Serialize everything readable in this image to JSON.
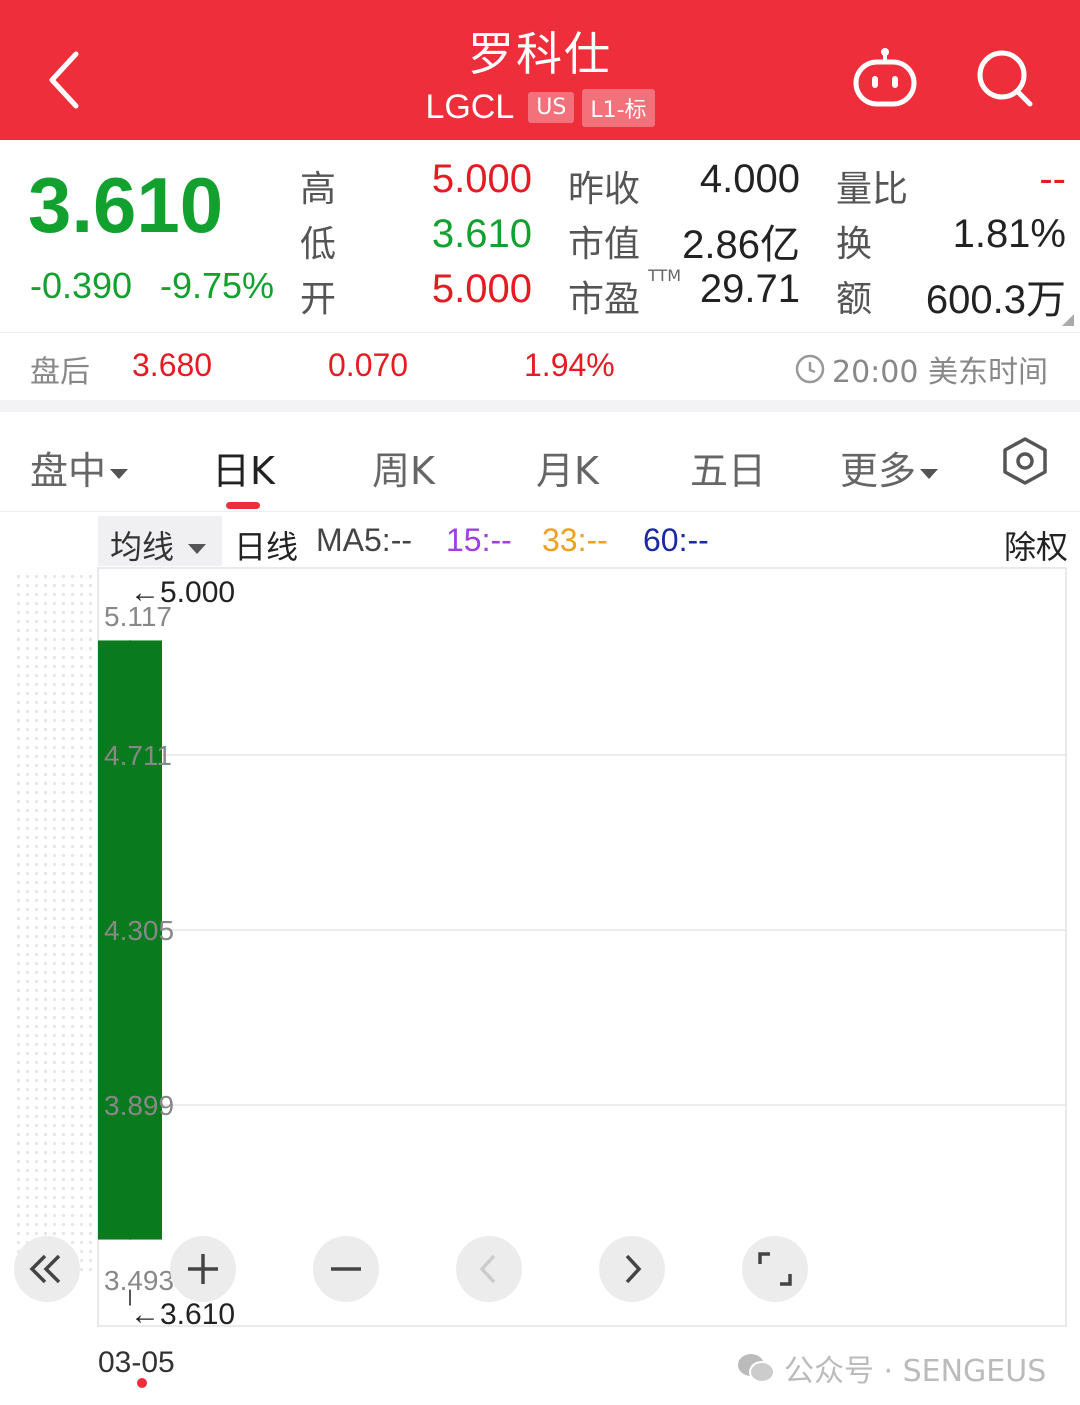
{
  "colors": {
    "brand": "#ee2f3b",
    "up": "#e41b23",
    "down": "#12a12f",
    "ma15": "#a23ee0",
    "ma33": "#f0a020",
    "ma60": "#1a2aa0"
  },
  "header": {
    "title": "罗科仕",
    "ticker": "LGCL",
    "market_badge": "US",
    "level_badge": "L1-标",
    "icons": [
      "back-icon",
      "robot-icon",
      "search-icon"
    ]
  },
  "quote": {
    "price": "3.610",
    "change": "-0.390",
    "change_pct": "-9.75%",
    "high_label": "高",
    "high": "5.000",
    "low_label": "低",
    "low": "3.610",
    "open_label": "开",
    "open": "5.000",
    "prev_close_label": "昨收",
    "prev_close": "4.000",
    "mkt_cap_label": "市值",
    "mkt_cap": "2.86亿",
    "pe_label": "市盈",
    "pe_tag": "TTM",
    "pe": "29.71",
    "vol_ratio_label": "量比",
    "vol_ratio": "--",
    "turnover_label": "换",
    "turnover": "1.81%",
    "amount_label": "额",
    "amount": "600.3万"
  },
  "after_hours": {
    "label": "盘后",
    "price": "3.680",
    "change": "0.070",
    "change_pct": "1.94%",
    "time": "20:00 美东时间"
  },
  "tabs": [
    {
      "label": "盘中"
    },
    {
      "label": "日K"
    },
    {
      "label": "周K"
    },
    {
      "label": "月K"
    },
    {
      "label": "五日"
    },
    {
      "label": "更多"
    }
  ],
  "indicator": {
    "selector": "均线",
    "line_type": "日线",
    "ma5": "MA5:--",
    "ma15": "15:--",
    "ma33": "33:--",
    "ma60": "60:--",
    "adjust": "除权"
  },
  "chart_data": {
    "type": "candlestick",
    "y_ticks": [
      "5.117",
      "4.711",
      "4.305",
      "3.899",
      "3.493"
    ],
    "ylim": [
      3.493,
      5.117
    ],
    "candles": [
      {
        "date": "03-05",
        "open": 5.0,
        "high": 5.0,
        "low": 3.61,
        "close": 3.61
      }
    ],
    "high_marker": "←5.000",
    "low_marker": "←3.610",
    "x_labels": [
      "03-05"
    ]
  },
  "watermark": "公众号 · SENGEUS"
}
